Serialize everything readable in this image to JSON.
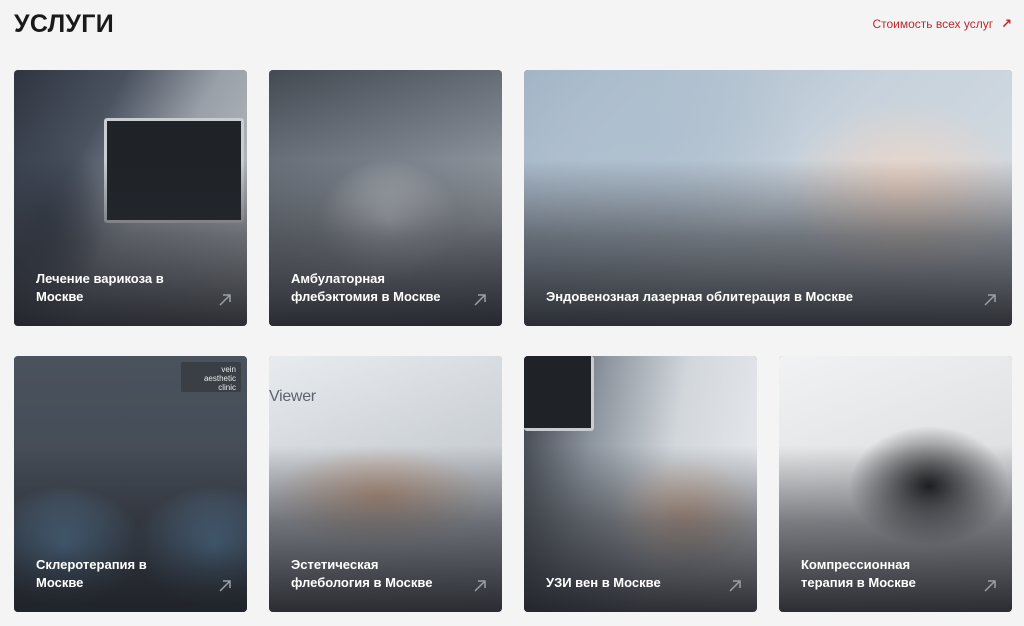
{
  "header": {
    "title": "УСЛУГИ",
    "all_prices_label": "Стоимость всех услуг",
    "accent_color": "#c0282d"
  },
  "services": [
    {
      "label": "Лечение варикоза в Москве",
      "icon": "arrow-up-right-icon"
    },
    {
      "label": "Амбулаторная флебэктомия в Москве",
      "icon": "arrow-up-right-icon"
    },
    {
      "label": "Эндовенозная лазерная облитерация в Москве",
      "icon": "arrow-up-right-icon"
    },
    {
      "label": "Склеротерапия в Москве",
      "icon": "arrow-up-right-icon"
    },
    {
      "label": "Эстетическая флебология в Москве",
      "icon": "arrow-up-right-icon"
    },
    {
      "label": "УЗИ вен в Москве",
      "icon": "arrow-up-right-icon"
    },
    {
      "label": "Компрессионная терапия в Москве",
      "icon": "arrow-up-right-icon"
    }
  ],
  "photo_overlays": {
    "clinic_logo_text": "vein aesthetic clinic",
    "device_brand_text": "Viewer"
  }
}
